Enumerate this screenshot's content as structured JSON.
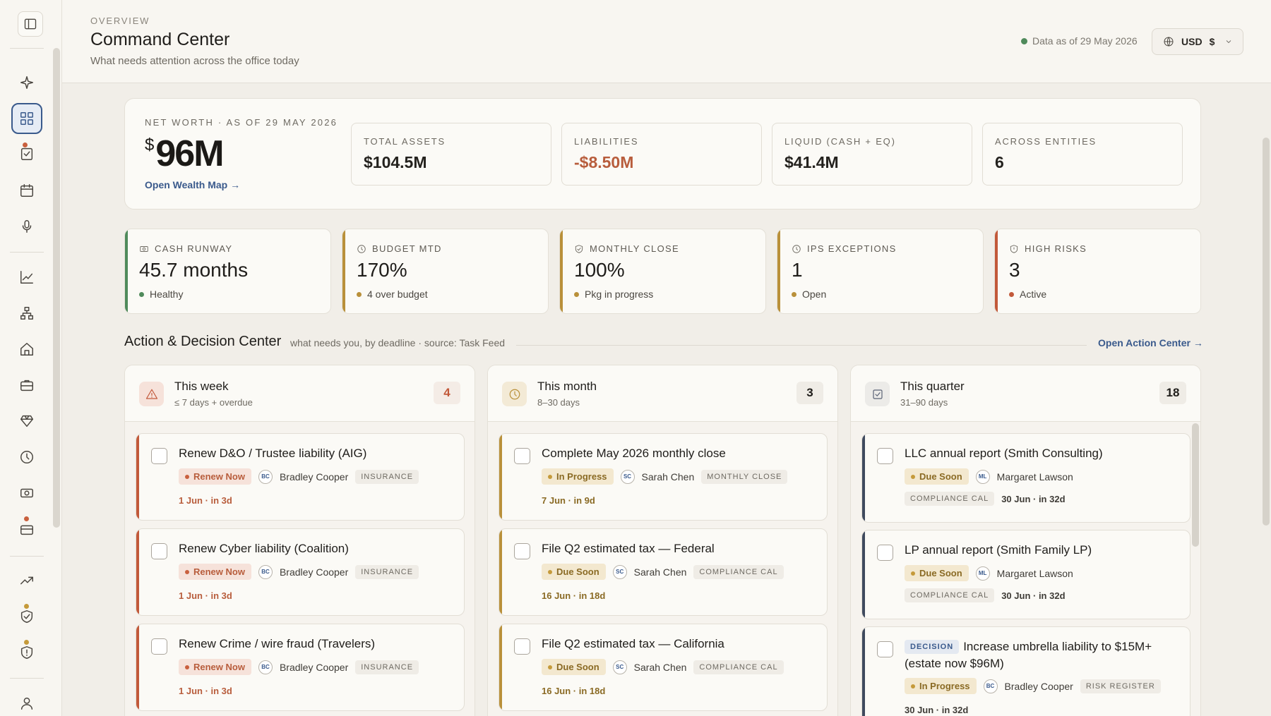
{
  "header": {
    "eyebrow": "OVERVIEW",
    "title": "Command Center",
    "subtitle": "What needs attention across the office today",
    "data_as_of": "Data as of 29 May 2026",
    "currency": "USD",
    "currency_symbol": "$"
  },
  "net_worth": {
    "label": "NET WORTH · AS OF 29 MAY 2026",
    "currency_symbol": "$",
    "value": "96M",
    "link": "Open Wealth Map →",
    "stats": [
      {
        "label": "TOTAL ASSETS",
        "value": "$104.5M"
      },
      {
        "label": "LIABILITIES",
        "value": "-$8.50M"
      },
      {
        "label": "LIQUID (CASH + EQ)",
        "value": "$41.4M"
      },
      {
        "label": "ACROSS ENTITIES",
        "value": "6"
      }
    ]
  },
  "kpis": [
    {
      "label": "CASH RUNWAY",
      "value": "45.7 months",
      "note": "Healthy",
      "color": "#4f8a5b",
      "icon": "cash-icon"
    },
    {
      "label": "BUDGET MTD",
      "value": "170%",
      "note": "4 over budget",
      "color": "#b9903a",
      "icon": "clock-icon"
    },
    {
      "label": "MONTHLY CLOSE",
      "value": "100%",
      "note": "Pkg in progress",
      "color": "#b9903a",
      "icon": "check-shield-icon"
    },
    {
      "label": "IPS EXCEPTIONS",
      "value": "1",
      "note": "Open",
      "color": "#b9903a",
      "icon": "clock-icon"
    },
    {
      "label": "HIGH RISKS",
      "value": "3",
      "note": "Active",
      "color": "#c2593a",
      "icon": "shield-alert-icon"
    }
  ],
  "action_center": {
    "title": "Action & Decision Center",
    "subtitle": "what needs you, by deadline · source: Task Feed",
    "link": "Open Action Center →"
  },
  "columns": [
    {
      "title": "This week",
      "range": "≤ 7 days + overdue",
      "count": "4",
      "tasks": [
        {
          "title": "Renew D&O / Trustee liability (AIG)",
          "status": "Renew Now",
          "initials": "BC",
          "assignee": "Bradley Cooper",
          "tag": "INSURANCE",
          "due": "1 Jun · in 3d"
        },
        {
          "title": "Renew Cyber liability (Coalition)",
          "status": "Renew Now",
          "initials": "BC",
          "assignee": "Bradley Cooper",
          "tag": "INSURANCE",
          "due": "1 Jun · in 3d"
        },
        {
          "title": "Renew Crime / wire fraud (Travelers)",
          "status": "Renew Now",
          "initials": "BC",
          "assignee": "Bradley Cooper",
          "tag": "INSURANCE",
          "due": "1 Jun · in 3d"
        }
      ]
    },
    {
      "title": "This month",
      "range": "8–30 days",
      "count": "3",
      "tasks": [
        {
          "title": "Complete May 2026 monthly close",
          "status": "In Progress",
          "initials": "SC",
          "assignee": "Sarah Chen",
          "tag": "MONTHLY CLOSE",
          "due": "7 Jun · in 9d"
        },
        {
          "title": "File Q2 estimated tax — Federal",
          "status": "Due Soon",
          "initials": "SC",
          "assignee": "Sarah Chen",
          "tag": "COMPLIANCE CAL",
          "due": "16 Jun · in 18d"
        },
        {
          "title": "File Q2 estimated tax — California",
          "status": "Due Soon",
          "initials": "SC",
          "assignee": "Sarah Chen",
          "tag": "COMPLIANCE CAL",
          "due": "16 Jun · in 18d"
        }
      ]
    },
    {
      "title": "This quarter",
      "range": "31–90 days",
      "count": "18",
      "tasks": [
        {
          "title": "LLC annual report (Smith Consulting)",
          "status": "Due Soon",
          "initials": "ML",
          "assignee": "Margaret Lawson",
          "tag": "COMPLIANCE CAL",
          "due": "30 Jun · in 32d"
        },
        {
          "title": "LP annual report (Smith Family LP)",
          "status": "Due Soon",
          "initials": "ML",
          "assignee": "Margaret Lawson",
          "tag": "COMPLIANCE CAL",
          "due": "30 Jun · in 32d"
        },
        {
          "title": "Increase umbrella liability to $15M+ (estate now $96M)",
          "badge": "DECISION",
          "status": "In Progress",
          "initials": "BC",
          "assignee": "Bradley Cooper",
          "tag": "RISK REGISTER",
          "due": "30 Jun · in 32d"
        }
      ]
    }
  ]
}
